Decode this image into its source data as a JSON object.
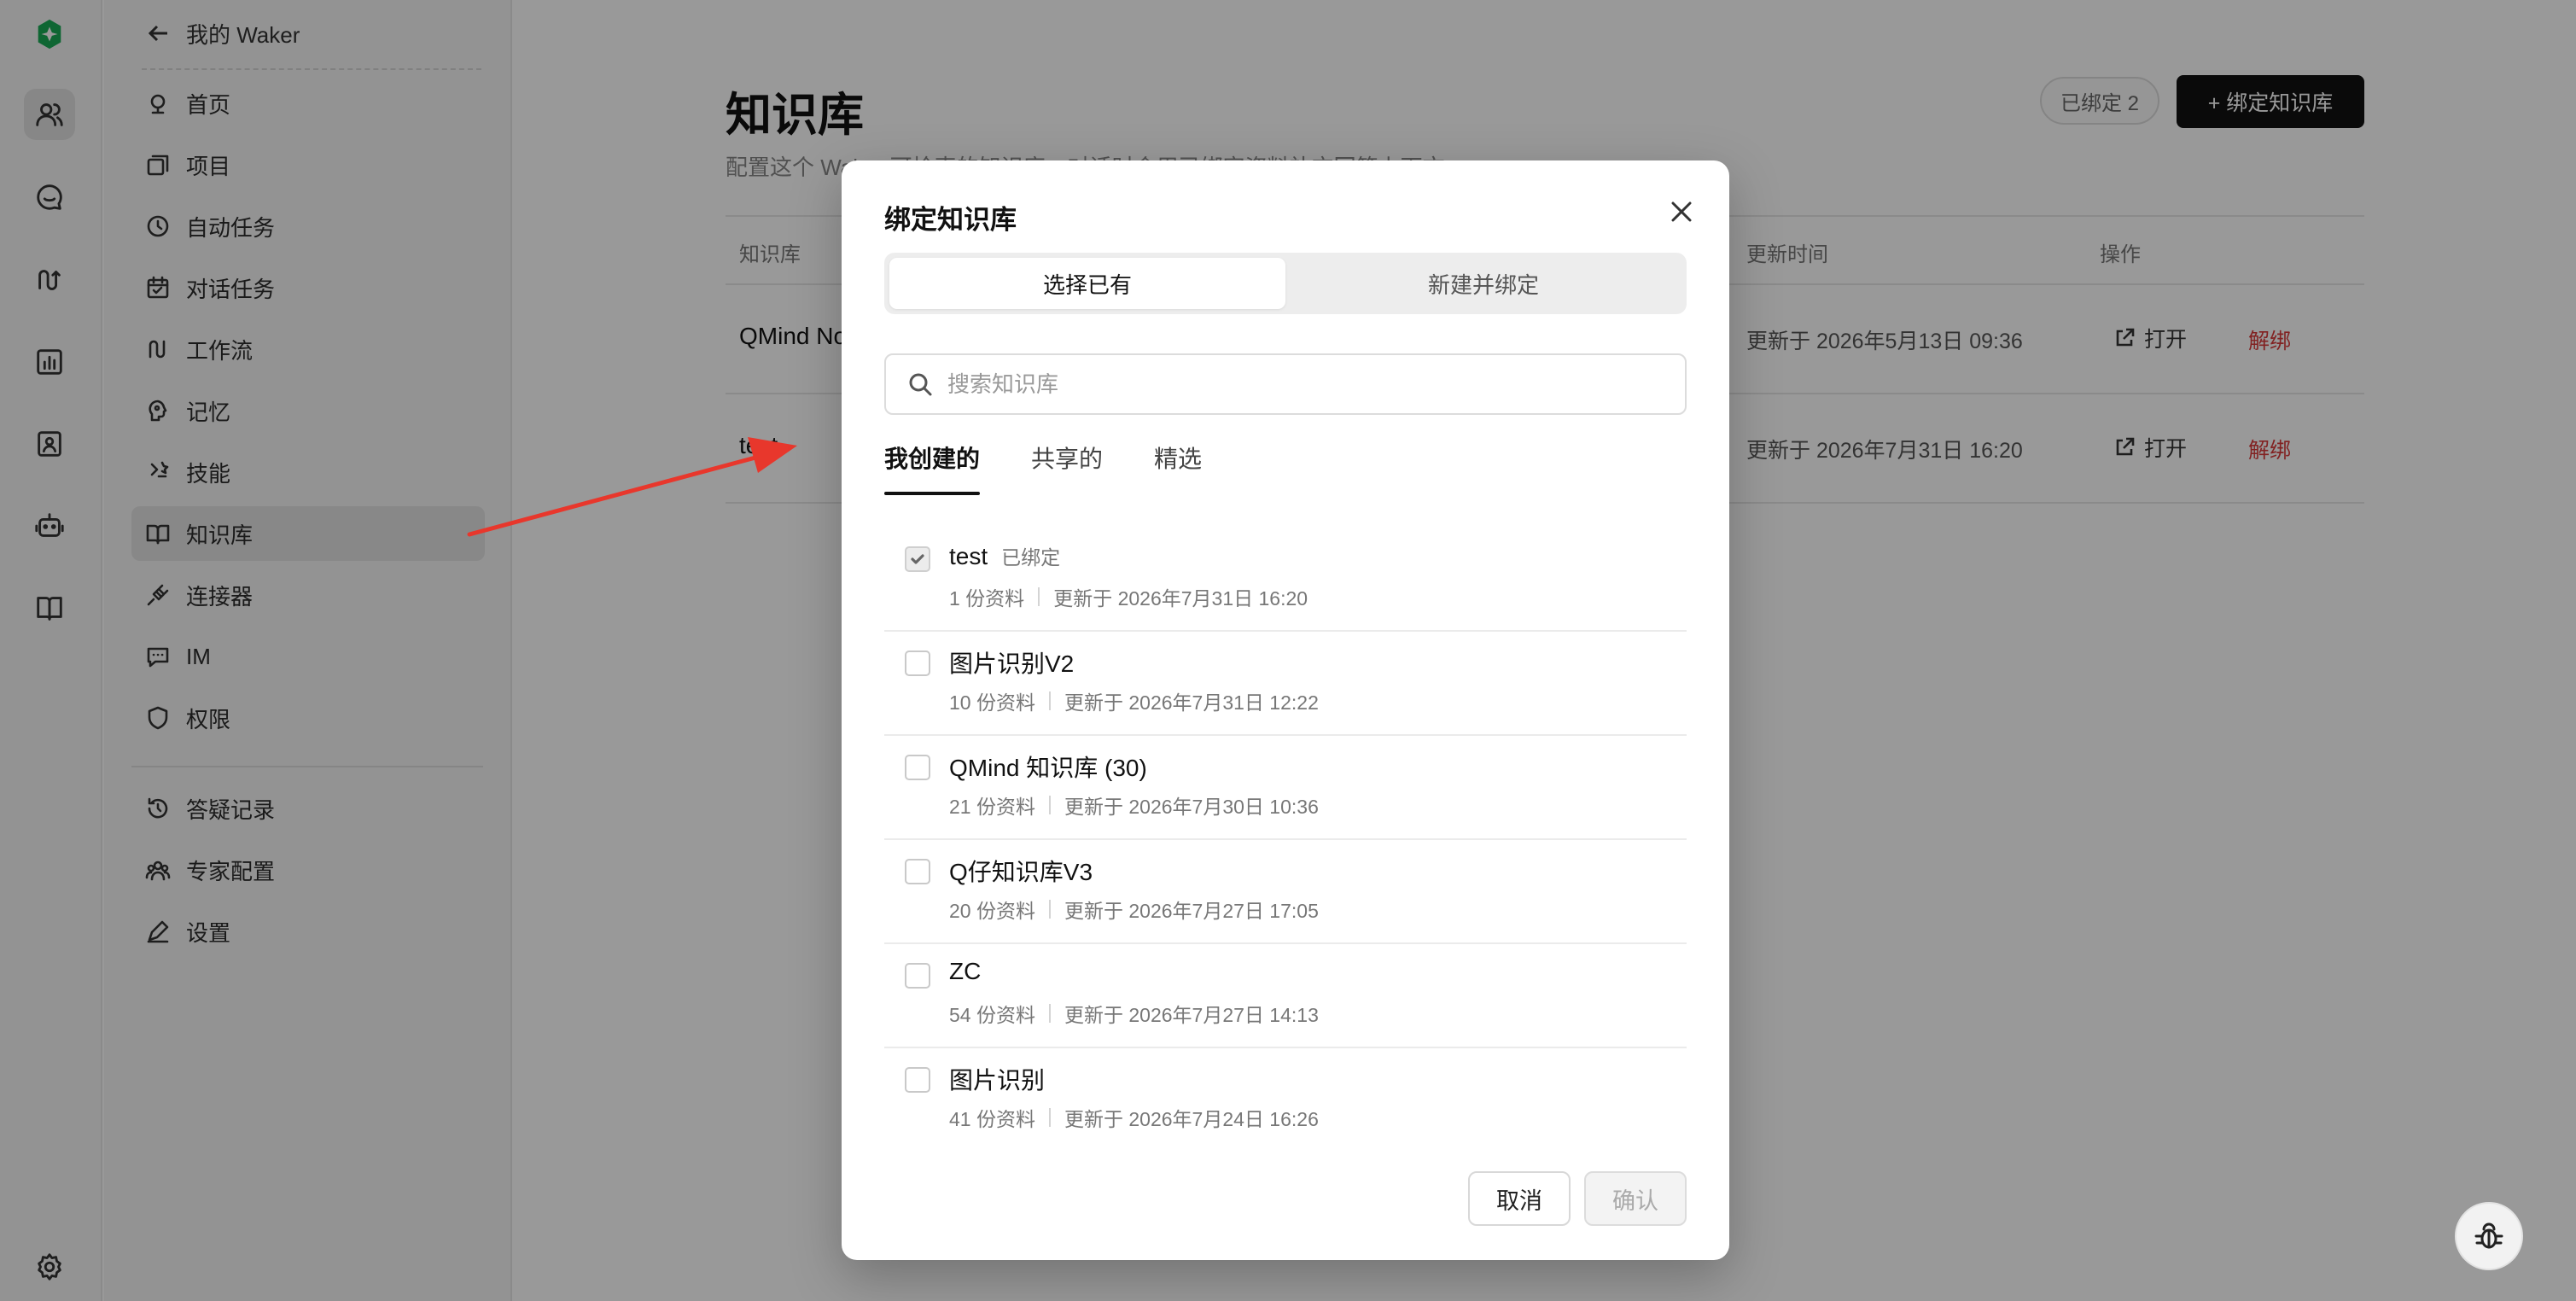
{
  "sidebar": {
    "back_label": "我的 Waker",
    "items": [
      {
        "label": "首页",
        "icon": "home-icon"
      },
      {
        "label": "项目",
        "icon": "project-icon"
      },
      {
        "label": "自动任务",
        "icon": "clock-icon"
      },
      {
        "label": "对话任务",
        "icon": "calendar-icon"
      },
      {
        "label": "工作流",
        "icon": "workflow-icon"
      },
      {
        "label": "记忆",
        "icon": "brain-icon"
      },
      {
        "label": "技能",
        "icon": "skill-icon"
      },
      {
        "label": "知识库",
        "icon": "book-icon",
        "active": true
      },
      {
        "label": "连接器",
        "icon": "plug-icon"
      },
      {
        "label": "IM",
        "icon": "message-icon"
      },
      {
        "label": "权限",
        "icon": "shield-icon"
      }
    ],
    "bottom_items": [
      {
        "label": "答疑记录",
        "icon": "history-icon"
      },
      {
        "label": "专家配置",
        "icon": "experts-icon"
      },
      {
        "label": "设置",
        "icon": "edit-icon"
      }
    ]
  },
  "page": {
    "title": "知识库",
    "description": "配置这个 Waker 可检索的知识库；对话时会用已绑定资料补充回答上下文。",
    "bound_count_label": "已绑定 2",
    "bind_button_label": "+ 绑定知识库",
    "table": {
      "columns": [
        "知识库",
        "更新时间",
        "操作"
      ],
      "rows": [
        {
          "name": "QMind Notes",
          "updated": "更新于 2026年5月13日 09:36",
          "open": "打开",
          "unbind": "解绑"
        },
        {
          "name": "test",
          "updated": "更新于 2026年7月31日 16:20",
          "open": "打开",
          "unbind": "解绑"
        }
      ]
    }
  },
  "modal": {
    "title": "绑定知识库",
    "segments": [
      "选择已有",
      "新建并绑定"
    ],
    "search_placeholder": "搜索知识库",
    "tabs": [
      "我创建的",
      "共享的",
      "精选"
    ],
    "items": [
      {
        "name": "test",
        "tag": "已绑定",
        "count": "1 份资料",
        "updated": "更新于 2026年7月31日 16:20",
        "checked": true
      },
      {
        "name": "图片识别V2",
        "tag": "",
        "count": "10 份资料",
        "updated": "更新于 2026年7月31日 12:22",
        "checked": false
      },
      {
        "name": "QMind 知识库 (30)",
        "tag": "",
        "count": "21 份资料",
        "updated": "更新于 2026年7月30日 10:36",
        "checked": false
      },
      {
        "name": "Q仔知识库V3",
        "tag": "",
        "count": "20 份资料",
        "updated": "更新于 2026年7月27日 17:05",
        "checked": false
      },
      {
        "name": "ZC",
        "tag": "",
        "count": "54 份资料",
        "updated": "更新于 2026年7月27日 14:13",
        "checked": false
      },
      {
        "name": "图片识别",
        "tag": "",
        "count": "41 份资料",
        "updated": "更新于 2026年7月24日 16:26",
        "checked": false
      }
    ],
    "cancel_label": "取消",
    "confirm_label": "确认"
  },
  "colors": {
    "brand": "#1aaa55",
    "danger": "#d93a3a",
    "annotation_arrow": "#e8372c",
    "primary_button": "#111111"
  }
}
